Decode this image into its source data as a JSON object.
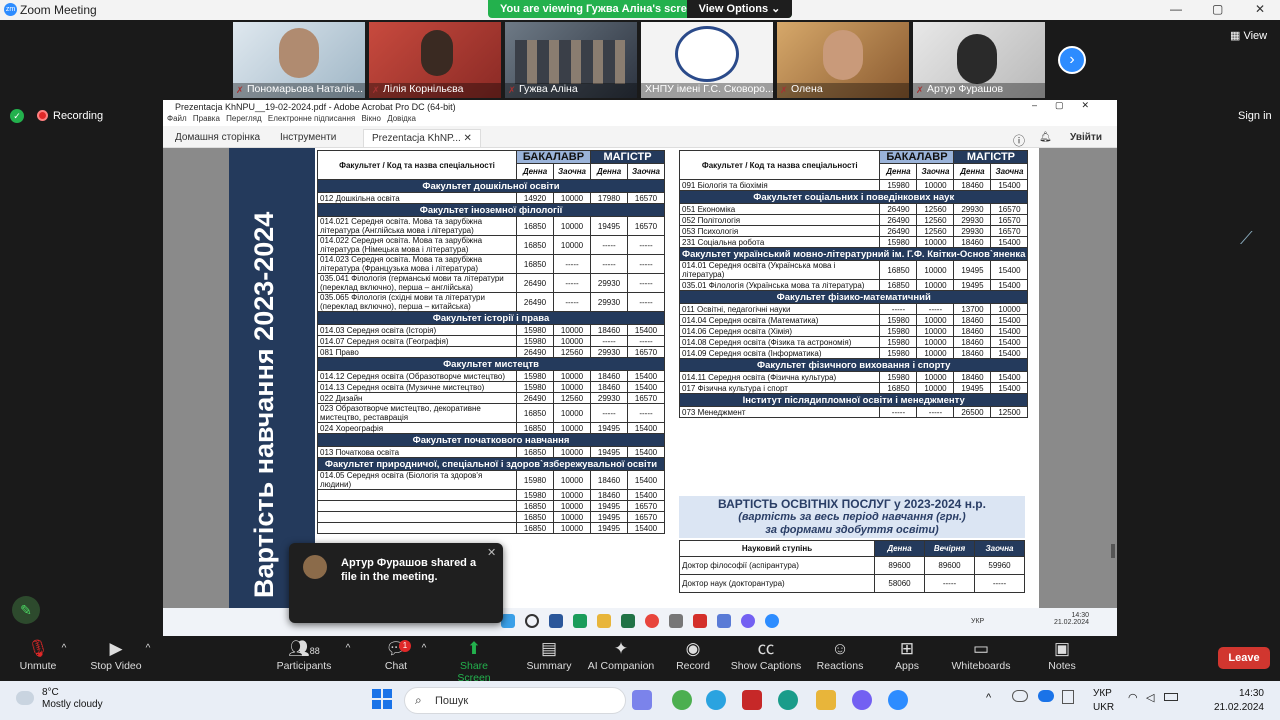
{
  "zoom": {
    "window_title": "Zoom Meeting",
    "viewing_text": "You are viewing Гужва Аліна's screen",
    "view_options": "View Options",
    "view_label": "View",
    "recording": "Recording",
    "sign_in": "Sign in",
    "participants": [
      {
        "name": "Пономарьова Наталія..."
      },
      {
        "name": "Лілія Корнільєва"
      },
      {
        "name": "Гужва Аліна"
      },
      {
        "name": "ХНПУ імені Г.С. Сковоро..."
      },
      {
        "name": "Олена"
      },
      {
        "name": "Артур Фурашов"
      }
    ],
    "toast": "Артур Фурашов shared a file in the meeting.",
    "toolbar": {
      "unmute": "Unmute",
      "stop_video": "Stop Video",
      "participants": "Participants",
      "participants_count": "88",
      "chat": "Chat",
      "chat_badge": "1",
      "share": "Share Screen",
      "summary": "Summary",
      "ai": "AI Companion",
      "record": "Record",
      "captions": "Show Captions",
      "reactions": "Reactions",
      "apps": "Apps",
      "whiteboards": "Whiteboards",
      "notes": "Notes",
      "leave": "Leave"
    }
  },
  "acrobat": {
    "title": "Prezentacja KhNPU__19-02-2024.pdf - Adobe Acrobat Pro DC (64-bit)",
    "menu": [
      "Файл",
      "Правка",
      "Перегляд",
      "Електронне підписання",
      "Вікно",
      "Довідка"
    ],
    "tab_home": "Домашня сторінка",
    "tab_tools": "Інструменти",
    "tab_doc": "Prezentacja KhNP...",
    "sign_in": "Увійти"
  },
  "doc": {
    "vertical_title": "Вартість навчання 2023-2024",
    "header": {
      "faculty": "Факультет / Код та назва спеціальності",
      "bachelor": "БАКАЛАВР",
      "master": "МАГІСТР",
      "day": "Денна",
      "ext": "Заочна"
    },
    "left": [
      {
        "sec": "Факультет дошкільної освіти"
      },
      {
        "n": "012 Дошкільна освіта",
        "v": [
          "14920",
          "10000",
          "17980",
          "16570"
        ]
      },
      {
        "sec": "Факультет іноземної філології"
      },
      {
        "n": "014.021 Середня освіта. Мова та зарубіжна література (Англійська мова і література)",
        "v": [
          "16850",
          "10000",
          "19495",
          "16570"
        ]
      },
      {
        "n": "014.022 Середня освіта. Мова та зарубіжна література (Німецька мова і література)",
        "v": [
          "16850",
          "10000",
          "-----",
          "-----"
        ]
      },
      {
        "n": "014.023 Середня освіта. Мова та зарубіжна література (Французька мова і література)",
        "v": [
          "16850",
          "-----",
          "-----",
          "-----"
        ]
      },
      {
        "n": "035.041 Філологія (германські мови та літератури (переклад включно), перша – англійська)",
        "v": [
          "26490",
          "-----",
          "29930",
          "-----"
        ]
      },
      {
        "n": "035.065 Філологія (східні мови та літератури (переклад включно), перша – китайська)",
        "v": [
          "26490",
          "-----",
          "29930",
          "-----"
        ]
      },
      {
        "sec": "Факультет історії і права"
      },
      {
        "n": "014.03 Середня освіта (Історія)",
        "v": [
          "15980",
          "10000",
          "18460",
          "15400"
        ]
      },
      {
        "n": "014.07 Середня освіта (Географія)",
        "v": [
          "15980",
          "10000",
          "-----",
          "-----"
        ]
      },
      {
        "n": "081 Право",
        "v": [
          "26490",
          "12560",
          "29930",
          "16570"
        ]
      },
      {
        "sec": "Факультет мистецтв"
      },
      {
        "n": "014.12 Середня освіта (Образотворче мистецтво)",
        "v": [
          "15980",
          "10000",
          "18460",
          "15400"
        ]
      },
      {
        "n": "014.13 Середня освіта (Музичне мистецтво)",
        "v": [
          "15980",
          "10000",
          "18460",
          "15400"
        ]
      },
      {
        "n": "022 Дизайн",
        "v": [
          "26490",
          "12560",
          "29930",
          "16570"
        ]
      },
      {
        "n": "023 Образотворче мистецтво, декоративне мистецтво, реставрація",
        "v": [
          "16850",
          "10000",
          "-----",
          "-----"
        ]
      },
      {
        "n": "024 Хореографія",
        "v": [
          "16850",
          "10000",
          "19495",
          "15400"
        ]
      },
      {
        "sec": "Факультет початкового навчання"
      },
      {
        "n": "013 Початкова освіта",
        "v": [
          "16850",
          "10000",
          "19495",
          "15400"
        ]
      },
      {
        "sec": "Факультет природничої, спеціальної і здоров`язбережувальної освіти"
      },
      {
        "n": "014.05 Середня освіта (Біологія та здоров'я людини)",
        "v": [
          "15980",
          "10000",
          "18460",
          "15400"
        ]
      },
      {
        "n": "",
        "v": [
          "15980",
          "10000",
          "18460",
          "15400"
        ]
      },
      {
        "n": "",
        "v": [
          "16850",
          "10000",
          "19495",
          "16570"
        ]
      },
      {
        "n": "",
        "v": [
          "16850",
          "10000",
          "19495",
          "16570"
        ]
      },
      {
        "n": "",
        "v": [
          "16850",
          "10000",
          "19495",
          "15400"
        ]
      }
    ],
    "right": [
      {
        "n": "091 Біологія та біохімія",
        "v": [
          "15980",
          "10000",
          "18460",
          "15400"
        ]
      },
      {
        "sec": "Факультет соціальних і поведінкових наук"
      },
      {
        "n": "051 Економіка",
        "v": [
          "26490",
          "12560",
          "29930",
          "16570"
        ]
      },
      {
        "n": "052 Політологія",
        "v": [
          "26490",
          "12560",
          "29930",
          "16570"
        ]
      },
      {
        "n": "053 Психологія",
        "v": [
          "26490",
          "12560",
          "29930",
          "16570"
        ]
      },
      {
        "n": "231 Соціальна робота",
        "v": [
          "15980",
          "10000",
          "18460",
          "15400"
        ]
      },
      {
        "sec": "Факультет український мовно-літературний ім. Г.Ф. Квітки-Основ`яненка"
      },
      {
        "n": "014.01 Середня освіта (Українська мова і література)",
        "v": [
          "16850",
          "10000",
          "19495",
          "15400"
        ]
      },
      {
        "n": "035.01 Філологія (Українська мова та література)",
        "v": [
          "16850",
          "10000",
          "19495",
          "15400"
        ]
      },
      {
        "sec": "Факультет фізико-математичний"
      },
      {
        "n": "011 Освітні, педагогічні науки",
        "v": [
          "-----",
          "-----",
          "13700",
          "10000"
        ]
      },
      {
        "n": "014.04 Середня освіта (Математика)",
        "v": [
          "15980",
          "10000",
          "18460",
          "15400"
        ]
      },
      {
        "n": "014.06 Середня освіта (Хімія)",
        "v": [
          "15980",
          "10000",
          "18460",
          "15400"
        ]
      },
      {
        "n": "014.08 Середня освіта (Фізика та астрономія)",
        "v": [
          "15980",
          "10000",
          "18460",
          "15400"
        ]
      },
      {
        "n": "014.09 Середня освіта (Інформатика)",
        "v": [
          "15980",
          "10000",
          "18460",
          "15400"
        ]
      },
      {
        "sec": "Факультет фізичного виховання і спорту"
      },
      {
        "n": "014.11 Середня освіта (Фізична культура)",
        "v": [
          "15980",
          "10000",
          "18460",
          "15400"
        ]
      },
      {
        "n": "017 Фізична культура і спорт",
        "v": [
          "16850",
          "10000",
          "19495",
          "15400"
        ]
      },
      {
        "sec": "Інститут післядипломної освіти і менеджменту"
      },
      {
        "n": "073 Менеджмент",
        "v": [
          "-----",
          "-----",
          "26500",
          "12500"
        ]
      }
    ],
    "info": {
      "line1": "ВАРТІСТЬ ОСВІТНІХ ПОСЛУГ у 2023-2024 н.р.",
      "line2": "(вартість за весь період навчання (грн.)",
      "line3": "за формами здобуття освіти)",
      "col0": "Науковий ступінь",
      "col1": "Денна",
      "col2": "Вечірня",
      "col3": "Заочна",
      "rows": [
        {
          "n": "Доктор філософії (аспірантура)",
          "v": [
            "89600",
            "89600",
            "59960"
          ]
        },
        {
          "n": "Доктор наук (докторантура)",
          "v": [
            "58060",
            "-----",
            "-----"
          ]
        }
      ]
    },
    "inner_clock": {
      "time": "14:30",
      "date": "21.02.2024",
      "lang": "УКР"
    }
  },
  "windows": {
    "temp": "8°C",
    "weather": "Mostly cloudy",
    "search": "Пошук",
    "lang1": "УКР",
    "lang2": "UKR",
    "time": "14:30",
    "date": "21.02.2024"
  },
  "colors": {
    "zoom_green": "#23b14d",
    "navy": "#243a5c",
    "leave_red": "#d1362f"
  }
}
